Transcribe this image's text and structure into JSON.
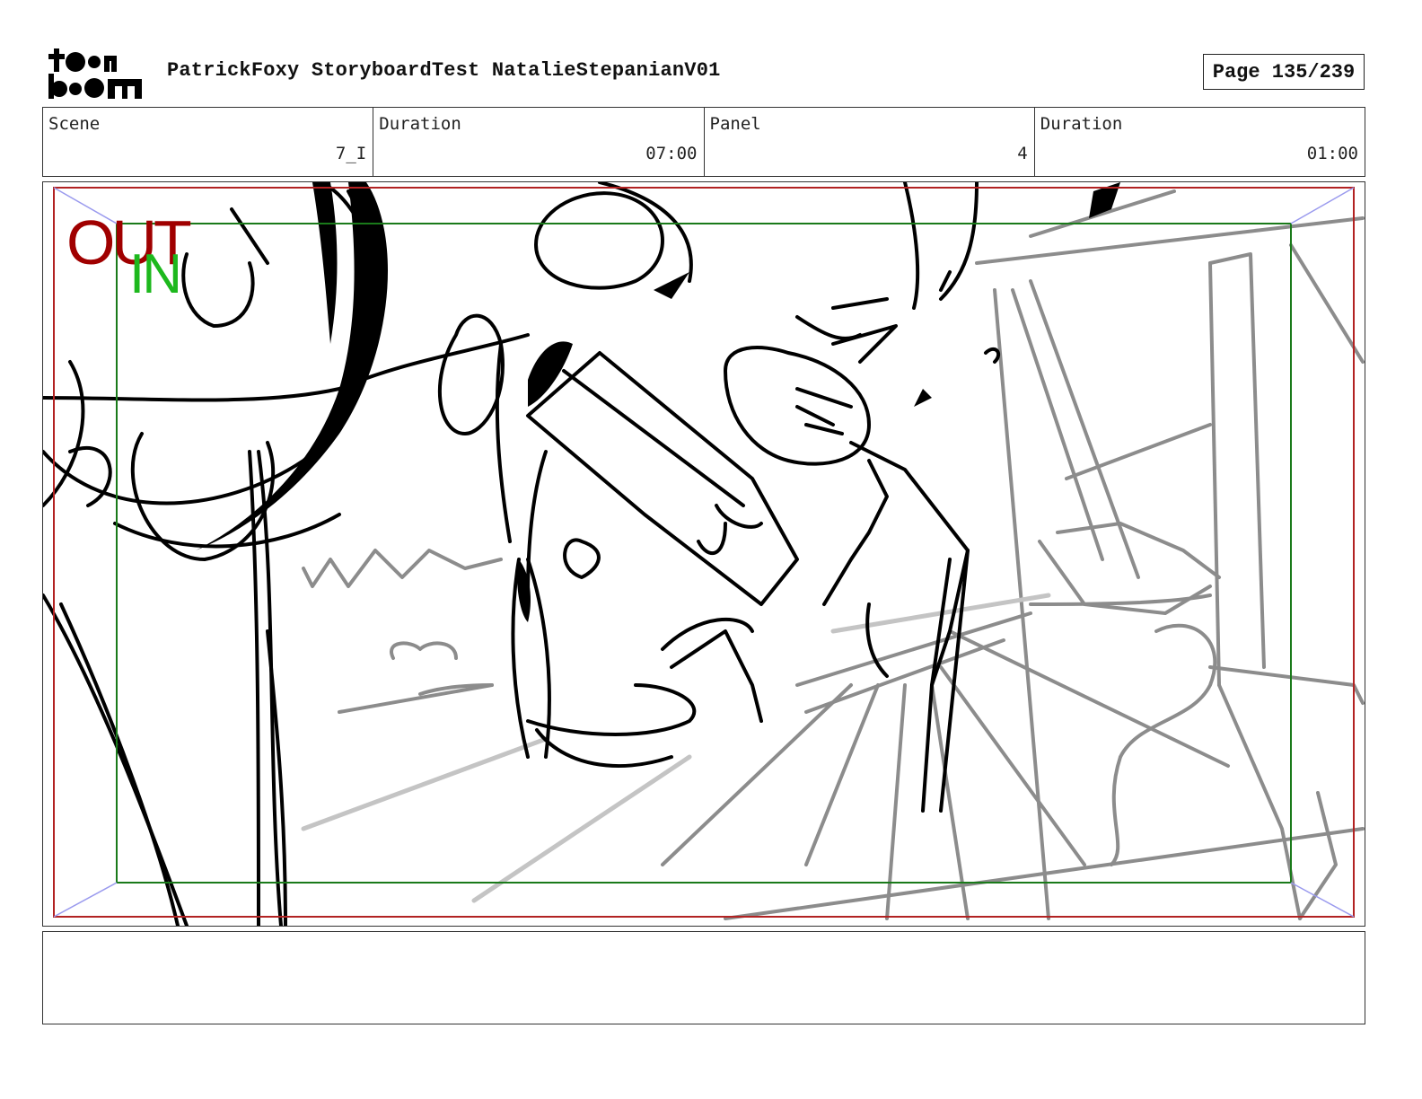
{
  "header": {
    "logo_text_top": "toon",
    "logo_text_bottom": "boom",
    "title": "PatrickFoxy StoryboardTest NatalieStepanianV01",
    "page": "Page 135/239"
  },
  "info": {
    "scene_label": "Scene",
    "scene_value": "7_I",
    "scene_duration_label": "Duration",
    "scene_duration_value": "07:00",
    "panel_label": "Panel",
    "panel_value": "4",
    "panel_duration_label": "Duration",
    "panel_duration_value": "01:00"
  },
  "panel": {
    "out_label": "OUT",
    "in_label": "IN",
    "colors": {
      "out_frame": "#b22222",
      "in_frame": "#1a7a1a",
      "safe_corners": "#9a9aee",
      "sketch_dark": "#000000",
      "sketch_light": "#8c8c8c"
    }
  },
  "notes": {
    "text": ""
  }
}
